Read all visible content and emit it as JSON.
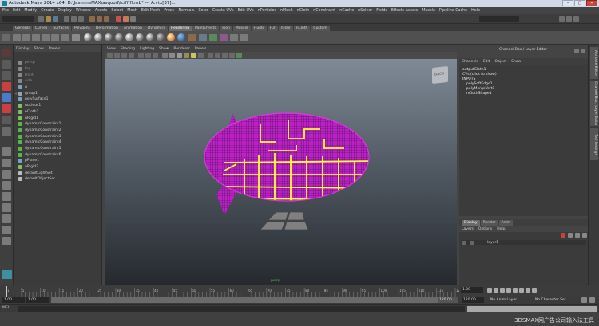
{
  "window": {
    "title": "Autodesk Maya 2014 x64: D:\\JasmineMAX\\asqood\\fcffffff.mb* --- A.vtx[37]..."
  },
  "menubar": [
    "File",
    "Edit",
    "Modify",
    "Create",
    "Display",
    "Window",
    "Assets",
    "Select",
    "Mesh",
    "Edit Mesh",
    "Proxy",
    "Normals",
    "Color",
    "Create UVs",
    "Edit UVs",
    "nParticles",
    "nMesh",
    "nCloth",
    "nConstraint",
    "nCache",
    "nSolver",
    "Fields",
    "Effects Assets",
    "Muscle",
    "Pipeline Cache",
    "Help"
  ],
  "shelf_tabs": [
    "General",
    "Curves",
    "Surfaces",
    "Polygons",
    "Deformation",
    "Animation",
    "Dynamics",
    "Rendering",
    "PaintEffects",
    "Toon",
    "Muscle",
    "Fluids",
    "Fur",
    "nHair",
    "nCloth",
    "Custom"
  ],
  "shelf_tabs_active": 7,
  "outliner": {
    "menu": [
      "Display",
      "Show",
      "Panels"
    ],
    "items": [
      {
        "label": "persp",
        "dim": true,
        "color": "#888888"
      },
      {
        "label": "top",
        "dim": true,
        "color": "#888888"
      },
      {
        "label": "front",
        "dim": true,
        "color": "#888888"
      },
      {
        "label": "side",
        "dim": true,
        "color": "#888888"
      },
      {
        "label": "A",
        "dim": false,
        "color": "#7aa0c8"
      },
      {
        "label": "group1",
        "dim": false,
        "color": "#9aa0a6"
      },
      {
        "label": "polySurface1",
        "dim": false,
        "color": "#7aa0c8"
      },
      {
        "label": "nucleus1",
        "dim": false,
        "color": "#7fbf5f"
      },
      {
        "label": "nCloth1",
        "dim": false,
        "color": "#7fbf5f"
      },
      {
        "label": "nRigid1",
        "dim": false,
        "color": "#7fbf5f"
      },
      {
        "label": "dynamicConstraint1",
        "dim": false,
        "color": "#59b54a"
      },
      {
        "label": "dynamicConstraint2",
        "dim": false,
        "color": "#59b54a"
      },
      {
        "label": "dynamicConstraint3",
        "dim": false,
        "color": "#59b54a"
      },
      {
        "label": "dynamicConstraint4",
        "dim": false,
        "color": "#59b54a"
      },
      {
        "label": "dynamicConstraint5",
        "dim": false,
        "color": "#59b54a"
      },
      {
        "label": "dynamicConstraint6",
        "dim": false,
        "color": "#59b54a"
      },
      {
        "label": "pPlane1",
        "dim": false,
        "color": "#7aa0c8"
      },
      {
        "label": "nRigid2",
        "dim": false,
        "color": "#7fbf5f"
      },
      {
        "label": "defaultLightSet",
        "dim": false,
        "color": "#bbbbbb"
      },
      {
        "label": "defaultObjectSet",
        "dim": false,
        "color": "#bbbbbb"
      }
    ]
  },
  "viewport": {
    "menu": [
      "View",
      "Shading",
      "Lighting",
      "Show",
      "Renderer",
      "Panels"
    ],
    "viewcube_label": "BACK",
    "camera_label": "persp"
  },
  "channel_box": {
    "header": "Channel Box / Layer Editor",
    "menu": [
      "Channels",
      "Edit",
      "Object",
      "Show"
    ],
    "lines": [
      "outputCloth1",
      "CVs (click to show)",
      "INPUTS",
      "polySoftEdge1",
      "polyMergeVert1",
      "nClothShape1"
    ]
  },
  "layer_editor": {
    "tabs": [
      "Display",
      "Render",
      "Anim"
    ],
    "active_tab": 0,
    "menu": [
      "Layers",
      "Options",
      "Help"
    ],
    "layer_name": "layer1"
  },
  "side_tabs": [
    "Attribute Editor",
    "Channel Box / Layer Editor",
    "Tool Settings"
  ],
  "timeline": {
    "ticks": [
      "1",
      "5",
      "10",
      "15",
      "20",
      "25",
      "30",
      "35",
      "40",
      "45",
      "50",
      "55",
      "60",
      "65",
      "70",
      "75",
      "80",
      "85",
      "90",
      "95",
      "100",
      "105",
      "110",
      "115",
      "120"
    ],
    "current_frame": "1.00"
  },
  "range_slider": {
    "start": "1.00",
    "start_inner": "1.00",
    "end_inner": "120.00",
    "end": "120.00",
    "anim_layer": "No Anim Layer",
    "char_set": "No Character Set"
  },
  "command_line": {
    "label": "MEL"
  },
  "watermark": "3DSMAX网广告公司输入法工具"
}
